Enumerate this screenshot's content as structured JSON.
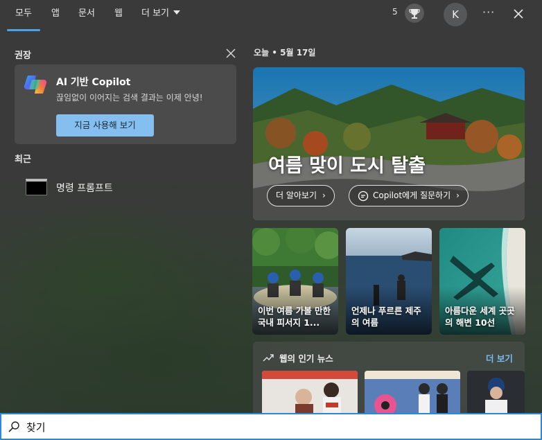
{
  "tabs": [
    {
      "label": "모두",
      "active": true
    },
    {
      "label": "앱"
    },
    {
      "label": "문서"
    },
    {
      "label": "웹"
    },
    {
      "label": "더 보기"
    }
  ],
  "header": {
    "points": "5",
    "trophy_icon": "trophy-icon",
    "avatar_initial": "K",
    "more_label": "···",
    "close_icon": "close-icon"
  },
  "recommended": {
    "title": "권장",
    "copilot": {
      "title": "AI 기반 Copilot",
      "description": "끊임없이 이어지는 검색 결과는 이제 안녕!",
      "button": "지금 사용해 보기"
    }
  },
  "recent": {
    "title": "최근",
    "items": [
      {
        "label": "명령 프롬프트",
        "icon": "command-prompt-icon"
      }
    ]
  },
  "today": {
    "label": "오늘",
    "date": "5월 17일",
    "hero": {
      "title": "여름 맞이 도시 탈출",
      "learn_more": "더 알아보기",
      "ask_copilot": "Copilot에게 질문하기"
    },
    "cards": [
      {
        "caption": "이번 여름 가볼 만한 국내 피서지 1..."
      },
      {
        "caption": "언제나 푸르른 제주의 여름"
      },
      {
        "caption": "아름다운 세계 곳곳의 해변 10선"
      }
    ]
  },
  "news": {
    "title": "웹의 인기 뉴스",
    "more": "더 보기"
  },
  "search": {
    "value": "찾기",
    "placeholder": "찾기"
  },
  "colors": {
    "accent": "#4aa3e6",
    "button": "#84bff0",
    "link": "#7bbcf0"
  }
}
